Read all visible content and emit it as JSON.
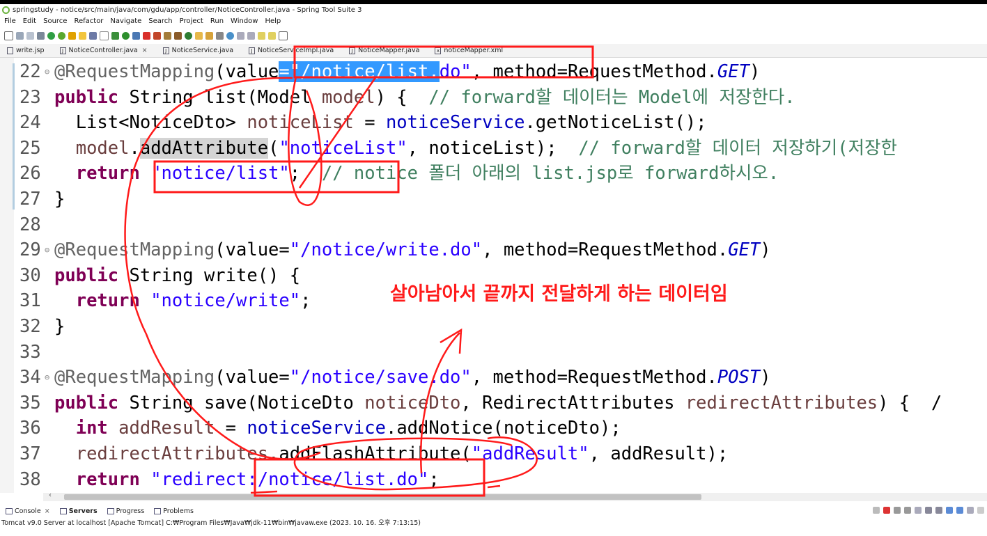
{
  "window": {
    "title": "springstudy - notice/src/main/java/com/gdu/app/controller/NoticeController.java - Spring Tool Suite 3"
  },
  "menu": [
    "File",
    "Edit",
    "Source",
    "Refactor",
    "Navigate",
    "Search",
    "Project",
    "Run",
    "Window",
    "Help"
  ],
  "tabs": [
    {
      "label": "write.jsp",
      "icon": "jsp-file-icon"
    },
    {
      "label": "NoticeController.java",
      "icon": "java-file-icon",
      "active": true
    },
    {
      "label": "NoticeService.java",
      "icon": "java-file-icon"
    },
    {
      "label": "NoticeServiceImpl.java",
      "icon": "java-file-icon"
    },
    {
      "label": "NoticeMapper.java",
      "icon": "java-file-icon"
    },
    {
      "label": "noticeMapper.xml",
      "icon": "xml-file-icon"
    }
  ],
  "editor": {
    "line_numbers": [
      "22",
      "23",
      "24",
      "25",
      "26",
      "27",
      "28",
      "29",
      "30",
      "31",
      "32",
      "33",
      "34",
      "35",
      "36",
      "37",
      "38"
    ],
    "fold_markers": {
      "22": "⊖",
      "29": "⊖",
      "34": "⊖"
    },
    "lines": [
      [
        [
          "ann",
          "@RequestMapping"
        ],
        [
          "t",
          "(value"
        ],
        [
          "sel",
          "=\"/notice/list."
        ],
        [
          "str",
          "do\""
        ],
        [
          "t",
          ", method=RequestMethod."
        ],
        [
          "fld",
          "GET"
        ],
        [
          "t",
          ")"
        ]
      ],
      [
        [
          "kw",
          "public"
        ],
        [
          "t",
          " String list(Model "
        ],
        [
          "loc",
          "model"
        ],
        [
          "t",
          ") {  "
        ],
        [
          "cm",
          "// forward할 데이터는 Model에 저장한다."
        ]
      ],
      [
        [
          "t",
          "  List<NoticeDto> "
        ],
        [
          "loc",
          "noticeList"
        ],
        [
          "t",
          " = "
        ],
        [
          "fld2",
          "noticeService"
        ],
        [
          "t",
          ".getNoticeList();"
        ]
      ],
      [
        [
          "t",
          "  "
        ],
        [
          "loc",
          "model"
        ],
        [
          "t",
          "."
        ],
        [
          "hl",
          "addAttribute"
        ],
        [
          "t",
          "("
        ],
        [
          "str",
          "\"noticeList\""
        ],
        [
          "t",
          ", noticeList);  "
        ],
        [
          "cm",
          "// forward할 데이터 저장하기(저장한"
        ]
      ],
      [
        [
          "t",
          "  "
        ],
        [
          "kw",
          "return"
        ],
        [
          "t",
          " "
        ],
        [
          "str",
          "\"notice/list\""
        ],
        [
          "t",
          ";  "
        ],
        [
          "cm",
          "// notice 폴더 아래의 list.jsp로 forward하시오."
        ]
      ],
      [
        [
          "t",
          "}"
        ]
      ],
      [
        [
          "t",
          ""
        ]
      ],
      [
        [
          "ann",
          "@RequestMapping"
        ],
        [
          "t",
          "(value="
        ],
        [
          "str",
          "\"/notice/write.do\""
        ],
        [
          "t",
          ", method=RequestMethod."
        ],
        [
          "fld",
          "GET"
        ],
        [
          "t",
          ")"
        ]
      ],
      [
        [
          "kw",
          "public"
        ],
        [
          "t",
          " String write() {"
        ]
      ],
      [
        [
          "t",
          "  "
        ],
        [
          "kw",
          "return"
        ],
        [
          "t",
          " "
        ],
        [
          "str",
          "\"notice/write\""
        ],
        [
          "t",
          ";"
        ]
      ],
      [
        [
          "t",
          "}"
        ]
      ],
      [
        [
          "t",
          ""
        ]
      ],
      [
        [
          "ann",
          "@RequestMapping"
        ],
        [
          "t",
          "(value="
        ],
        [
          "str",
          "\"/notice/save.do\""
        ],
        [
          "t",
          ", method=RequestMethod."
        ],
        [
          "fld",
          "POST"
        ],
        [
          "t",
          ")"
        ]
      ],
      [
        [
          "kw",
          "public"
        ],
        [
          "t",
          " String save(NoticeDto "
        ],
        [
          "loc",
          "noticeDto"
        ],
        [
          "t",
          ", RedirectAttributes "
        ],
        [
          "loc",
          "redirectAttributes"
        ],
        [
          "t",
          ") {  /"
        ]
      ],
      [
        [
          "t",
          "  "
        ],
        [
          "kw",
          "int"
        ],
        [
          "t",
          " "
        ],
        [
          "loc",
          "addResult"
        ],
        [
          "t",
          " = "
        ],
        [
          "fld2",
          "noticeService"
        ],
        [
          "t",
          ".addNotice(noticeDto);"
        ]
      ],
      [
        [
          "t",
          "  "
        ],
        [
          "loc",
          "redirectAttributes"
        ],
        [
          "t",
          ".addFlashAttribute("
        ],
        [
          "str",
          "\"addResult\""
        ],
        [
          "t",
          ", addResult);"
        ]
      ],
      [
        [
          "t",
          "  "
        ],
        [
          "kw",
          "return"
        ],
        [
          "t",
          " "
        ],
        [
          "str",
          "\"redirect:/notice/list.do\""
        ],
        [
          "t",
          ";"
        ]
      ]
    ]
  },
  "annotation": {
    "text": "살아남아서 끝까지 전달하게 하는 데이터임",
    "color": "#ff1a1a"
  },
  "console": {
    "tabs": [
      "Console",
      "Servers",
      "Progress",
      "Problems"
    ],
    "status": "Tomcat v9.0 Server at localhost [Apache Tomcat] C:₩Program Files₩Java₩jdk-11₩bin₩javaw.exe  (2023. 10. 16. 오후 7:13:15)"
  }
}
